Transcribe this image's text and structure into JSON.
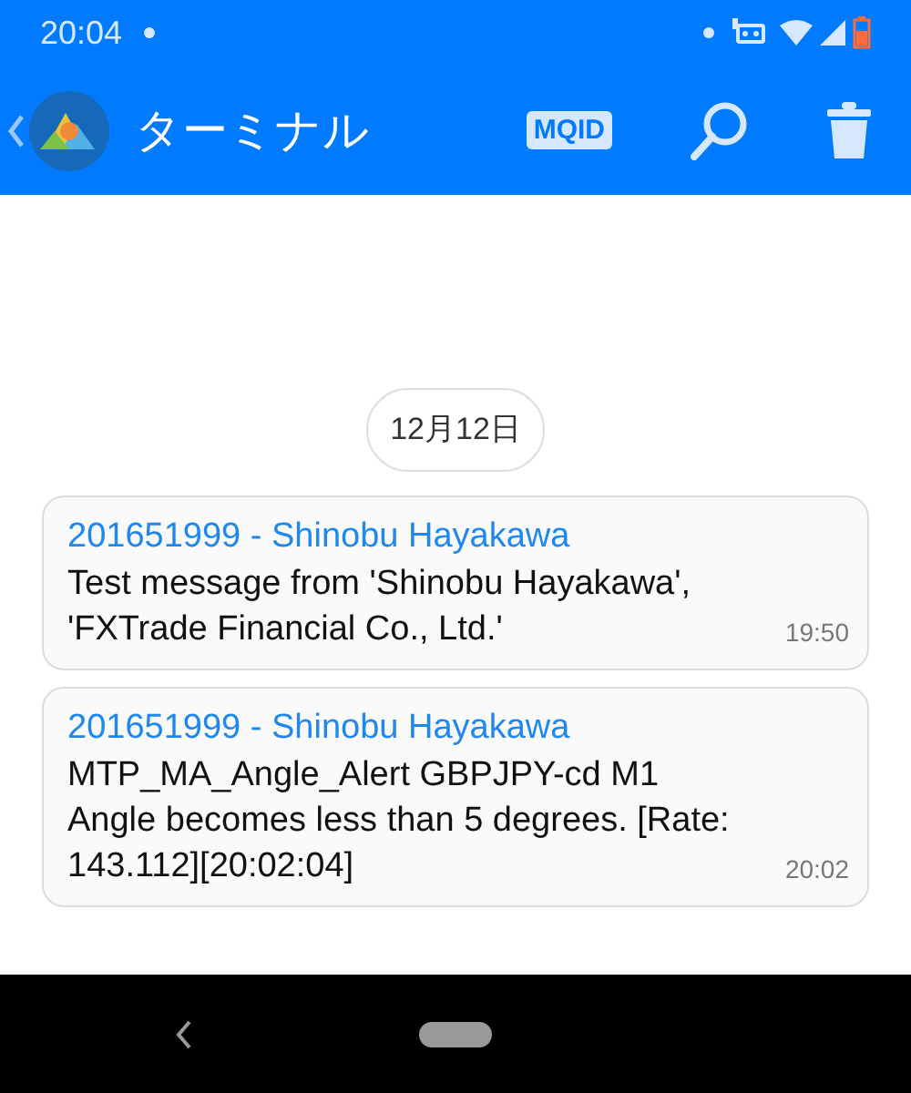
{
  "status_bar": {
    "time": "20:04"
  },
  "app_bar": {
    "title": "ターミナル",
    "mqid_badge": "MQID"
  },
  "date_chip": "12月12日",
  "messages": [
    {
      "sender": "201651999 - Shinobu Hayakawa",
      "text": "Test message from 'Shinobu Hayakawa', 'FXTrade Financial Co., Ltd.'",
      "time": "19:50"
    },
    {
      "sender": "201651999 - Shinobu Hayakawa",
      "text": "MTP_MA_Angle_Alert GBPJPY-cd M1 Angle becomes less than 5 degrees. [Rate: 143.112][20:02:04]",
      "time": "20:02"
    }
  ]
}
